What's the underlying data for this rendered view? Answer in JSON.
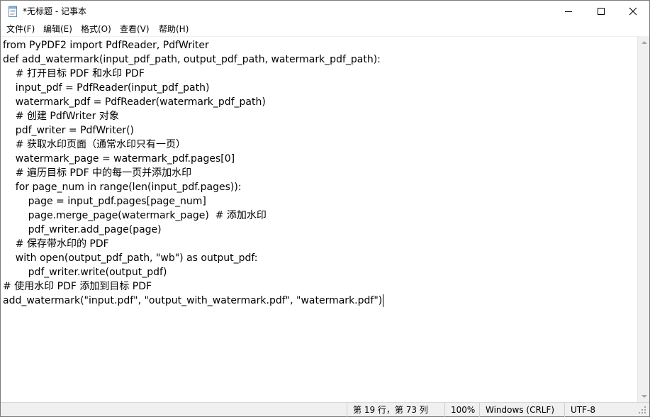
{
  "window": {
    "title": "*无标题 - 记事本",
    "icon": "notepad-icon",
    "controls": {
      "minimize": "minimize-icon",
      "maximize": "maximize-icon",
      "close": "close-icon"
    }
  },
  "menu": [
    {
      "label": "文件(F)"
    },
    {
      "label": "编辑(E)"
    },
    {
      "label": "格式(O)"
    },
    {
      "label": "查看(V)"
    },
    {
      "label": "帮助(H)"
    }
  ],
  "editor": {
    "lines": [
      "from PyPDF2 import PdfReader, PdfWriter",
      "def add_watermark(input_pdf_path, output_pdf_path, watermark_pdf_path):",
      "    # 打开目标 PDF 和水印 PDF",
      "    input_pdf = PdfReader(input_pdf_path)",
      "    watermark_pdf = PdfReader(watermark_pdf_path)",
      "    # 创建 PdfWriter 对象",
      "    pdf_writer = PdfWriter()",
      "    # 获取水印页面（通常水印只有一页）",
      "    watermark_page = watermark_pdf.pages[0]",
      "    # 遍历目标 PDF 中的每一页并添加水印",
      "    for page_num in range(len(input_pdf.pages)):",
      "        page = input_pdf.pages[page_num]",
      "        page.merge_page(watermark_page)  # 添加水印",
      "        pdf_writer.add_page(page)",
      "    # 保存带水印的 PDF",
      "    with open(output_pdf_path, \"wb\") as output_pdf:",
      "        pdf_writer.write(output_pdf)",
      "# 使用水印 PDF 添加到目标 PDF",
      "add_watermark(\"input.pdf\", \"output_with_watermark.pdf\", \"watermark.pdf\")"
    ]
  },
  "status": {
    "position": "第 19 行，第 73 列",
    "zoom": "100%",
    "line_ending": "Windows (CRLF)",
    "encoding": "UTF-8"
  }
}
